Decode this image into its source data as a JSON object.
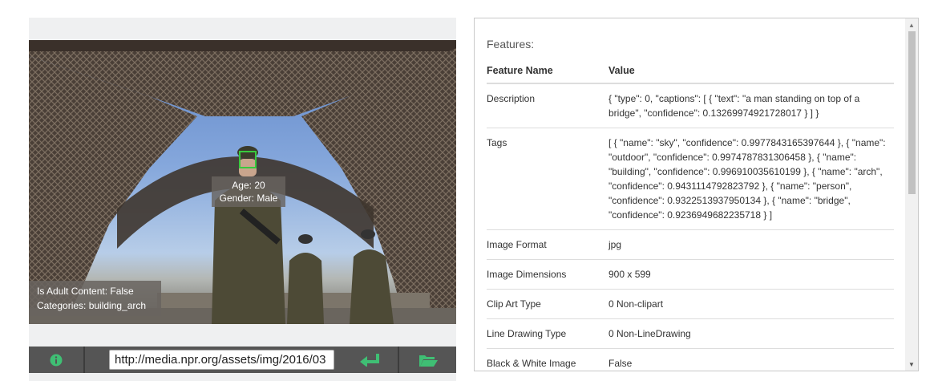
{
  "image": {
    "face": {
      "age_label": "Age:",
      "age_value": "20",
      "gender_label": "Gender:",
      "gender_value": "Male"
    },
    "adult_line": "Is Adult Content: False",
    "categories_line": "Categories: building_arch"
  },
  "toolbar": {
    "info_icon": "info-icon",
    "url_value": "http://media.npr.org/assets/img/2016/03",
    "submit_icon": "enter-arrow-icon",
    "folder_icon": "folder-open-icon",
    "icon_color": "#3fbf74"
  },
  "features": {
    "heading": "Features:",
    "col_name": "Feature Name",
    "col_value": "Value",
    "rows": [
      {
        "name": "Description",
        "value": "{ \"type\": 0, \"captions\": [ { \"text\": \"a man standing on top of a bridge\", \"confidence\": 0.13269974921728017 } ] }"
      },
      {
        "name": "Tags",
        "value": "[ { \"name\": \"sky\", \"confidence\": 0.9977843165397644 }, { \"name\": \"outdoor\", \"confidence\": 0.9974787831306458 }, { \"name\": \"building\", \"confidence\": 0.996910035610199 }, { \"name\": \"arch\", \"confidence\": 0.9431114792823792 }, { \"name\": \"person\", \"confidence\": 0.9322513937950134 }, { \"name\": \"bridge\", \"confidence\": 0.9236949682235718 } ]"
      },
      {
        "name": "Image Format",
        "value": "jpg"
      },
      {
        "name": "Image Dimensions",
        "value": "900 x 599"
      },
      {
        "name": "Clip Art Type",
        "value": "0 Non-clipart"
      },
      {
        "name": "Line Drawing Type",
        "value": "0 Non-LineDrawing"
      },
      {
        "name": "Black & White Image",
        "value": "False"
      }
    ]
  }
}
